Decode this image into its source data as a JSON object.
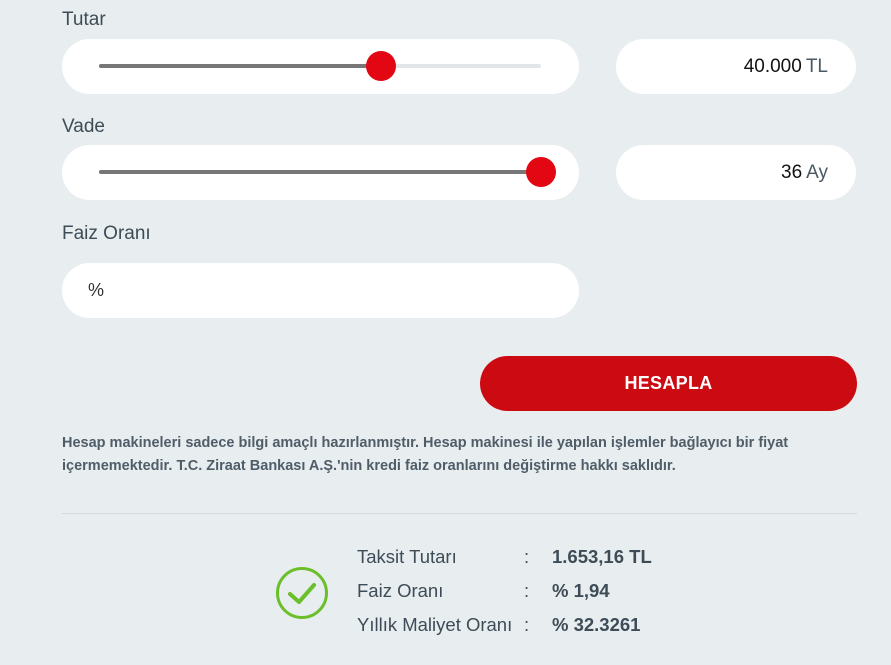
{
  "amount": {
    "label": "Tutar",
    "value": "40.000",
    "unit": "TL",
    "slider_fraction": 0.637
  },
  "term": {
    "label": "Vade",
    "value": "36",
    "unit": "Ay",
    "slider_fraction": 1.0
  },
  "interest": {
    "label": "Faiz Oranı",
    "placeholder": "%"
  },
  "calculate_button": "HESAPLA",
  "disclaimer": "Hesap makineleri sadece bilgi amaçlı hazırlanmıştır. Hesap makinesi ile yapılan işlemler bağlayıcı bir fiyat içermemektedir. T.C. Ziraat Bankası A.Ş.'nin kredi faiz oranlarını değiştirme hakkı saklıdır.",
  "results": [
    {
      "label": "Taksit Tutarı",
      "colon": ":",
      "value": "1.653,16 TL"
    },
    {
      "label": "Faiz Oranı",
      "colon": ":",
      "value": "% 1,94"
    },
    {
      "label": "Yıllık Maliyet Oranı",
      "colon": ":",
      "value": "% 32.3261"
    }
  ],
  "colors": {
    "accent": "#e30613",
    "button": "#cc0a12",
    "success": "#6abf2a",
    "background": "#e8edef"
  },
  "icons": {
    "result_status": "check-circle-icon"
  }
}
